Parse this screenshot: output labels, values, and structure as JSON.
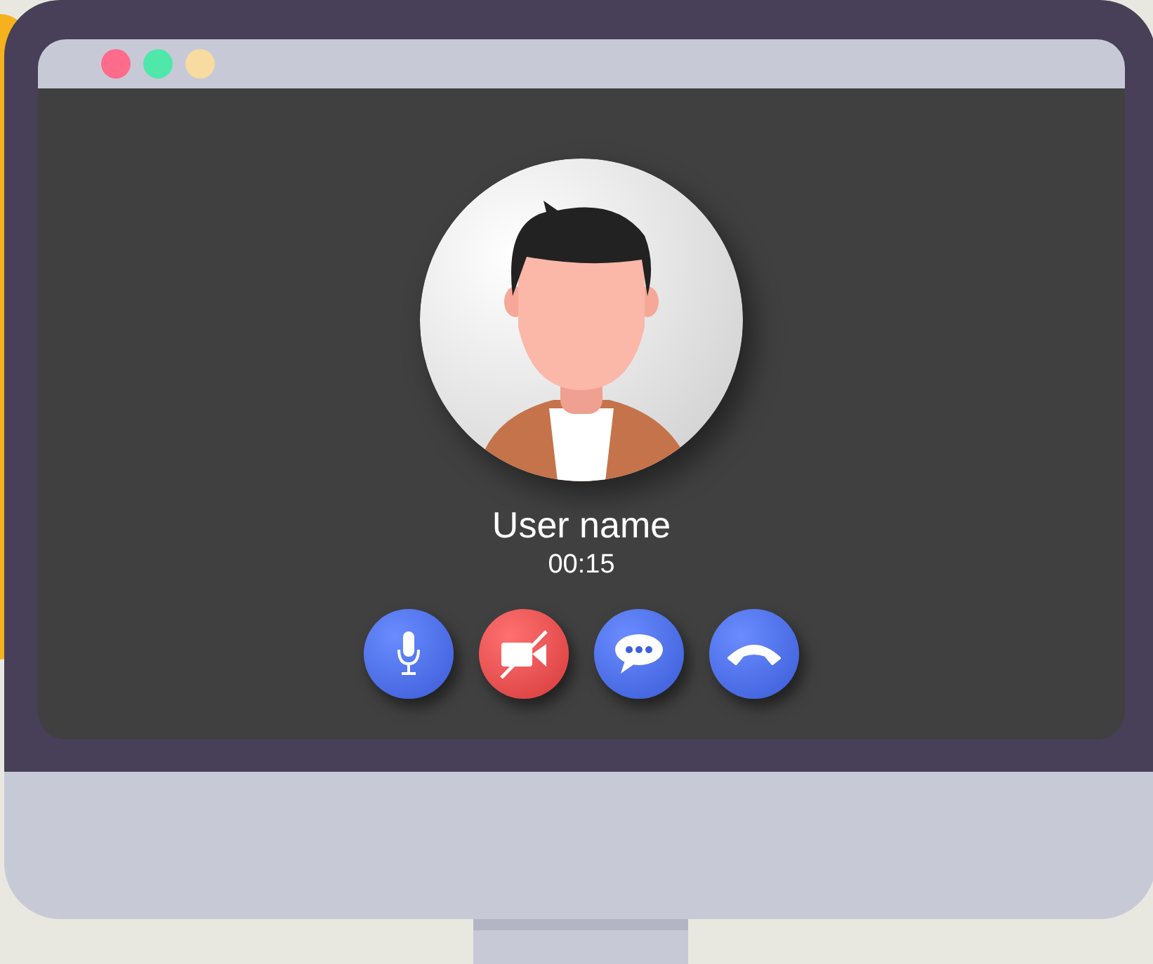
{
  "window": {
    "dots": [
      {
        "color": "#ff6b8b"
      },
      {
        "color": "#4fe8aa"
      },
      {
        "color": "#f7dba0"
      }
    ]
  },
  "call": {
    "user_name": "User name",
    "duration": "00:15"
  },
  "controls": [
    {
      "kind": "mic",
      "on": true
    },
    {
      "kind": "video",
      "on": false
    },
    {
      "kind": "chat",
      "on": true
    },
    {
      "kind": "hangup",
      "on": true
    }
  ]
}
